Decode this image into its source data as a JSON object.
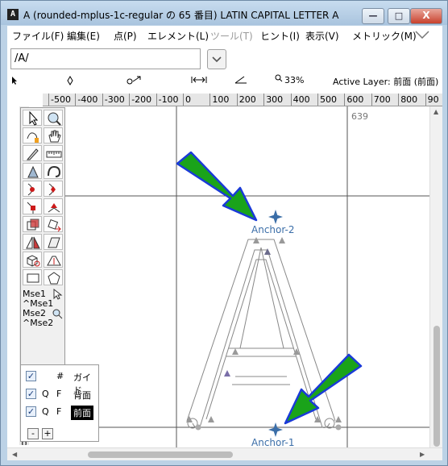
{
  "window": {
    "title": "A (rounded-mplus-1c-regular の 65 番目) LATIN CAPITAL LETTER A",
    "app_icon_text": "A",
    "minimize": "—",
    "maximize": "□",
    "close": "X"
  },
  "menu": {
    "items": [
      {
        "label": "ファイル(F)"
      },
      {
        "label": "編集(E)"
      },
      {
        "label": "点(P)"
      },
      {
        "label": "エレメント(L)"
      },
      {
        "label": "ツール(T)",
        "disabled": true
      },
      {
        "label": "ヒント(I)"
      },
      {
        "label": "表示(V)"
      },
      {
        "label": "メトリック(M)"
      }
    ]
  },
  "glyph_field": {
    "value": "/A/"
  },
  "status": {
    "zoom": "33%",
    "active_layer": "Active Layer: 前面 (前面)"
  },
  "ruler": {
    "labels": [
      "-500",
      "-400",
      "-300",
      "-200",
      "-100",
      "0",
      "100",
      "200",
      "300",
      "400",
      "500",
      "600",
      "700",
      "800",
      "90"
    ]
  },
  "vruler": {
    "digits": [
      "1",
      "0",
      "1",
      "0",
      "1",
      "0",
      "1",
      "0",
      "1",
      "0",
      "1",
      "0",
      "1",
      "0",
      "1",
      "0",
      "1",
      "0",
      "1",
      "0",
      "1",
      "0",
      "1",
      "0",
      "1",
      "0",
      "1",
      "0",
      "1",
      "0",
      "1",
      "0",
      "1",
      "0",
      "1",
      "0",
      "1",
      "0",
      "1",
      "0",
      "1",
      "0"
    ]
  },
  "canvas": {
    "width_label": "639",
    "anchors": [
      {
        "label": "Anchor-2"
      },
      {
        "label": "Anchor-1"
      }
    ],
    "arrow_color": "#1aa31a",
    "arrow_outline": "#1a3ad8",
    "anchor_color": "#3b6ea8"
  },
  "toolbox": {
    "mse": [
      {
        "label": "Mse1"
      },
      {
        "label": "^Mse1"
      },
      {
        "label": "Mse2"
      },
      {
        "label": "^Mse2"
      }
    ]
  },
  "layers": {
    "rows": [
      {
        "q": "",
        "f": "#",
        "name": "ガイド",
        "checked": "✓"
      },
      {
        "q": "Q",
        "f": "F",
        "name": "背面",
        "checked": "✓"
      },
      {
        "q": "Q",
        "f": "F",
        "name": "前面",
        "checked": "✓",
        "active": true
      }
    ],
    "minus": "-",
    "plus": "+"
  }
}
